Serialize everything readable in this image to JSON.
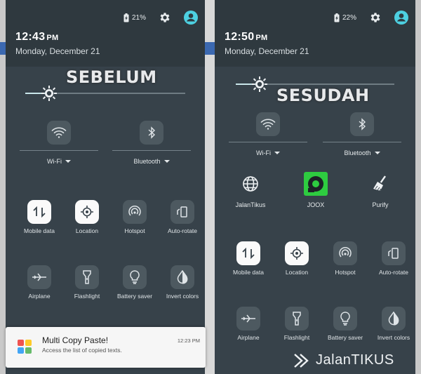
{
  "left": {
    "stamp": "SEBELUM",
    "battery": "21%",
    "time": "12:43",
    "ampm": "PM",
    "date": "Monday, December 21",
    "brightness": 0.15,
    "wifi_label": "Wi-Fi",
    "bluetooth_label": "Bluetooth",
    "tiles": [
      {
        "label": "Mobile data",
        "icon": "mobile-data-icon",
        "active": true
      },
      {
        "label": "Location",
        "icon": "location-icon",
        "active": true
      },
      {
        "label": "Hotspot",
        "icon": "hotspot-icon",
        "active": false
      },
      {
        "label": "Auto-rotate",
        "icon": "auto-rotate-icon",
        "active": false
      },
      {
        "label": "Airplane",
        "icon": "airplane-icon",
        "active": false
      },
      {
        "label": "Flashlight",
        "icon": "flashlight-icon",
        "active": false
      },
      {
        "label": "Battery saver",
        "icon": "battery-saver-icon",
        "active": false
      },
      {
        "label": "Invert colors",
        "icon": "invert-colors-icon",
        "active": false
      }
    ]
  },
  "right": {
    "stamp": "SESUDAH",
    "battery": "22%",
    "time": "12:50",
    "ampm": "PM",
    "date": "Monday, December 21",
    "brightness": 0.15,
    "wifi_label": "Wi-Fi",
    "bluetooth_label": "Bluetooth",
    "apps": [
      {
        "label": "JalanTikus",
        "icon": "globe-icon"
      },
      {
        "label": "JOOX",
        "icon": "joox-icon"
      },
      {
        "label": "Purify",
        "icon": "broom-icon"
      }
    ],
    "tiles": [
      {
        "label": "Mobile data",
        "icon": "mobile-data-icon",
        "active": true
      },
      {
        "label": "Location",
        "icon": "location-icon",
        "active": true
      },
      {
        "label": "Hotspot",
        "icon": "hotspot-icon",
        "active": false
      },
      {
        "label": "Auto-rotate",
        "icon": "auto-rotate-icon",
        "active": false
      },
      {
        "label": "Airplane",
        "icon": "airplane-icon",
        "active": false
      },
      {
        "label": "Flashlight",
        "icon": "flashlight-icon",
        "active": false
      },
      {
        "label": "Battery saver",
        "icon": "battery-saver-icon",
        "active": false
      },
      {
        "label": "Invert colors",
        "icon": "invert-colors-icon",
        "active": false
      }
    ]
  },
  "notification": {
    "title": "Multi Copy Paste!",
    "body": "Access the list of copied texts.",
    "time": "12:23 PM"
  },
  "watermark": "JalanTIKUS",
  "colors": {
    "panel": "#37424a",
    "header": "#2f393f",
    "accent": "#4dd0e1",
    "tile_off": "#4d5960",
    "tile_on": "#fafafa",
    "joox_green": "#2ecc40"
  }
}
